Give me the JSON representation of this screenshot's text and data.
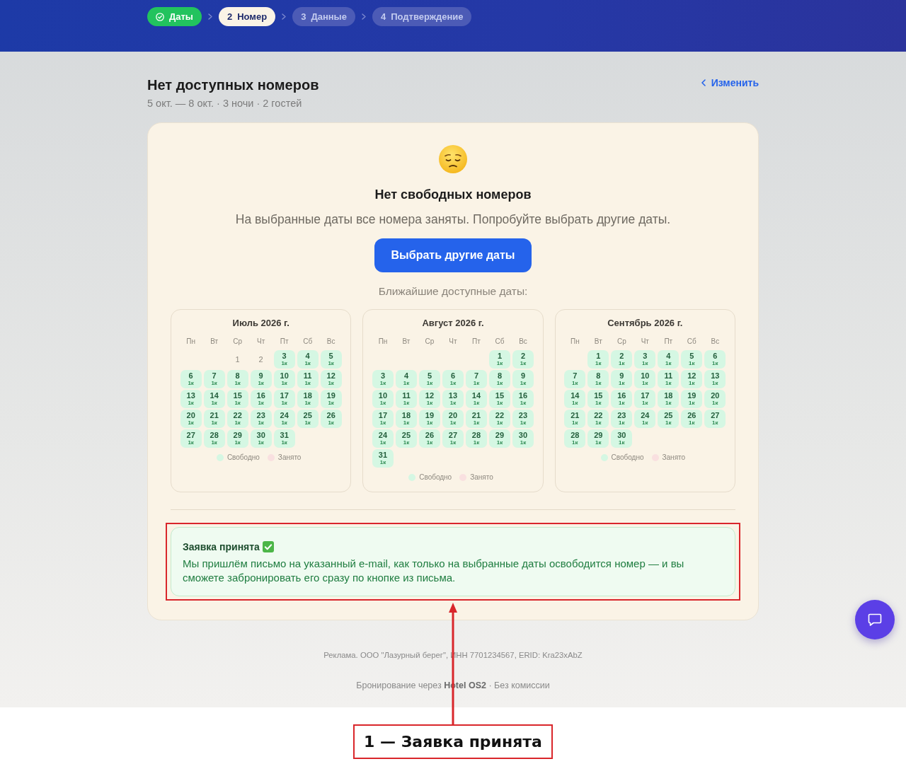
{
  "steps": [
    {
      "label": "Даты",
      "done": true,
      "selected": false
    },
    {
      "number": "2",
      "label": "Номер",
      "done": false,
      "selected": true
    },
    {
      "number": "3",
      "label": "Данные",
      "done": false,
      "selected": false
    },
    {
      "number": "4",
      "label": "Подтверждение",
      "done": false,
      "selected": false
    }
  ],
  "header": {
    "title": "Нет доступных номеров",
    "subtitle": "5 окт. — 8 окт. · 3 ночи · 2 гостей",
    "change_link": "Изменить"
  },
  "empty_state": {
    "title": "Нет свободных номеров",
    "message": "На выбранные даты все номера заняты. Попробуйте выбрать другие даты.",
    "button": "Выбрать другие даты"
  },
  "nearest_heading": "Ближайшие доступные даты:",
  "calendars": [
    {
      "title": "Июль 2026 г.",
      "weekdays": [
        "Пн",
        "Вт",
        "Ср",
        "Чт",
        "Пт",
        "Сб",
        "Вс"
      ],
      "weeks": [
        [
          {
            "day": "1",
            "available": false
          },
          {
            "day": "2",
            "available": false
          },
          {
            "day": "3",
            "rooms": "1к",
            "available": true
          },
          {
            "day": "4",
            "rooms": "1к",
            "available": true
          },
          {
            "day": "5",
            "rooms": "1к",
            "available": true
          }
        ],
        [
          {
            "day": "6",
            "rooms": "1к",
            "available": true
          },
          {
            "day": "7",
            "rooms": "1к",
            "available": true
          },
          {
            "day": "8",
            "rooms": "1к",
            "available": true
          },
          {
            "day": "9",
            "rooms": "1к",
            "available": true
          },
          {
            "day": "10",
            "rooms": "1к",
            "available": true
          },
          {
            "day": "11",
            "rooms": "1к",
            "available": true
          },
          {
            "day": "12",
            "rooms": "1к",
            "available": true
          }
        ],
        [
          {
            "day": "13",
            "rooms": "1к",
            "available": true
          },
          {
            "day": "14",
            "rooms": "1к",
            "available": true
          },
          {
            "day": "15",
            "rooms": "1к",
            "available": true
          },
          {
            "day": "16",
            "rooms": "1к",
            "available": true
          },
          {
            "day": "17",
            "rooms": "1к",
            "available": true
          },
          {
            "day": "18",
            "rooms": "1к",
            "available": true
          },
          {
            "day": "19",
            "rooms": "1к",
            "available": true
          }
        ],
        [
          {
            "day": "20",
            "rooms": "1к",
            "available": true
          },
          {
            "day": "21",
            "rooms": "1к",
            "available": true
          },
          {
            "day": "22",
            "rooms": "1к",
            "available": true
          },
          {
            "day": "23",
            "rooms": "1к",
            "available": true
          },
          {
            "day": "24",
            "rooms": "1к",
            "available": true
          },
          {
            "day": "25",
            "rooms": "1к",
            "available": true
          },
          {
            "day": "26",
            "rooms": "1к",
            "available": true
          }
        ],
        [
          {
            "day": "27",
            "rooms": "1к",
            "available": true
          },
          {
            "day": "28",
            "rooms": "1к",
            "available": true
          },
          {
            "day": "29",
            "rooms": "1к",
            "available": true
          },
          {
            "day": "30",
            "rooms": "1к",
            "available": true
          },
          {
            "day": "31",
            "rooms": "1к",
            "available": true
          }
        ]
      ],
      "legend": [
        {
          "label": "Свободно",
          "color": "#d5f7e3"
        },
        {
          "label": "Занято",
          "color": "#f9e0e0"
        }
      ]
    },
    {
      "title": "Август 2026 г.",
      "weekdays": [
        "Пн",
        "Вт",
        "Ср",
        "Чт",
        "Пт",
        "Сб",
        "Вс"
      ],
      "weeks": [
        [
          {
            "day": "1",
            "rooms": "1к",
            "available": true
          },
          {
            "day": "2",
            "rooms": "1к",
            "available": true
          }
        ],
        [
          {
            "day": "3",
            "rooms": "1к",
            "available": true
          },
          {
            "day": "4",
            "rooms": "1к",
            "available": true
          },
          {
            "day": "5",
            "rooms": "1к",
            "available": true
          },
          {
            "day": "6",
            "rooms": "1к",
            "available": true
          },
          {
            "day": "7",
            "rooms": "1к",
            "available": true
          },
          {
            "day": "8",
            "rooms": "1к",
            "available": true
          },
          {
            "day": "9",
            "rooms": "1к",
            "available": true
          }
        ],
        [
          {
            "day": "10",
            "rooms": "1к",
            "available": true
          },
          {
            "day": "11",
            "rooms": "1к",
            "available": true
          },
          {
            "day": "12",
            "rooms": "1к",
            "available": true
          },
          {
            "day": "13",
            "rooms": "1к",
            "available": true
          },
          {
            "day": "14",
            "rooms": "1к",
            "available": true
          },
          {
            "day": "15",
            "rooms": "1к",
            "available": true
          },
          {
            "day": "16",
            "rooms": "1к",
            "available": true
          }
        ],
        [
          {
            "day": "17",
            "rooms": "1к",
            "available": true
          },
          {
            "day": "18",
            "rooms": "1к",
            "available": true
          },
          {
            "day": "19",
            "rooms": "1к",
            "available": true
          },
          {
            "day": "20",
            "rooms": "1к",
            "available": true
          },
          {
            "day": "21",
            "rooms": "1к",
            "available": true
          },
          {
            "day": "22",
            "rooms": "1к",
            "available": true
          },
          {
            "day": "23",
            "rooms": "1к",
            "available": true
          }
        ],
        [
          {
            "day": "24",
            "rooms": "1к",
            "available": true
          },
          {
            "day": "25",
            "rooms": "1к",
            "available": true
          },
          {
            "day": "26",
            "rooms": "1к",
            "available": true
          },
          {
            "day": "27",
            "rooms": "1к",
            "available": true
          },
          {
            "day": "28",
            "rooms": "1к",
            "available": true
          },
          {
            "day": "29",
            "rooms": "1к",
            "available": true
          },
          {
            "day": "30",
            "rooms": "1к",
            "available": true
          }
        ],
        [
          {
            "day": "31",
            "rooms": "1к",
            "available": true
          }
        ]
      ],
      "legend": [
        {
          "label": "Свободно",
          "color": "#d5f7e3"
        },
        {
          "label": "Занято",
          "color": "#f9e0e0"
        }
      ]
    },
    {
      "title": "Сентябрь 2026 г.",
      "weekdays": [
        "Пн",
        "Вт",
        "Ср",
        "Чт",
        "Пт",
        "Сб",
        "Вс"
      ],
      "weeks": [
        [
          {
            "day": "1",
            "rooms": "1к",
            "available": true
          },
          {
            "day": "2",
            "rooms": "1к",
            "available": true
          },
          {
            "day": "3",
            "rooms": "1к",
            "available": true
          },
          {
            "day": "4",
            "rooms": "1к",
            "available": true
          },
          {
            "day": "5",
            "rooms": "1к",
            "available": true
          },
          {
            "day": "6",
            "rooms": "1к",
            "available": true
          }
        ],
        [
          {
            "day": "7",
            "rooms": "1к",
            "available": true
          },
          {
            "day": "8",
            "rooms": "1к",
            "available": true
          },
          {
            "day": "9",
            "rooms": "1к",
            "available": true
          },
          {
            "day": "10",
            "rooms": "1к",
            "available": true
          },
          {
            "day": "11",
            "rooms": "1к",
            "available": true
          },
          {
            "day": "12",
            "rooms": "1к",
            "available": true
          },
          {
            "day": "13",
            "rooms": "1к",
            "available": true
          }
        ],
        [
          {
            "day": "14",
            "rooms": "1к",
            "available": true
          },
          {
            "day": "15",
            "rooms": "1к",
            "available": true
          },
          {
            "day": "16",
            "rooms": "1к",
            "available": true
          },
          {
            "day": "17",
            "rooms": "1к",
            "available": true
          },
          {
            "day": "18",
            "rooms": "1к",
            "available": true
          },
          {
            "day": "19",
            "rooms": "1к",
            "available": true
          },
          {
            "day": "20",
            "rooms": "1к",
            "available": true
          }
        ],
        [
          {
            "day": "21",
            "rooms": "1к",
            "available": true
          },
          {
            "day": "22",
            "rooms": "1к",
            "available": true
          },
          {
            "day": "23",
            "rooms": "1к",
            "available": true
          },
          {
            "day": "24",
            "rooms": "1к",
            "available": true
          },
          {
            "day": "25",
            "rooms": "1к",
            "available": true
          },
          {
            "day": "26",
            "rooms": "1к",
            "available": true
          },
          {
            "day": "27",
            "rooms": "1к",
            "available": true
          }
        ],
        [
          {
            "day": "28",
            "rooms": "1к",
            "available": true
          },
          {
            "day": "29",
            "rooms": "1к",
            "available": true
          },
          {
            "day": "30",
            "rooms": "1к",
            "available": true
          }
        ]
      ],
      "legend": [
        {
          "label": "Свободно",
          "color": "#d5f7e3"
        },
        {
          "label": "Занято",
          "color": "#f9e0e0"
        }
      ]
    }
  ],
  "notice": {
    "title": "Заявка принята",
    "text": "Мы пришлём письмо на указанный e-mail, как только на выбранные даты освободится номер — и вы сможете забронировать его сразу по кнопке из письма."
  },
  "footer": {
    "ad_text": "Реклама. ООО \"Лазурный берег\", ИНН 7701234567, ERID: Kra23xAbZ",
    "credit": "Бронирование через **Hotel OS2** · Без комиссии"
  },
  "annotation": {
    "label": "1 — Заявка принята"
  }
}
